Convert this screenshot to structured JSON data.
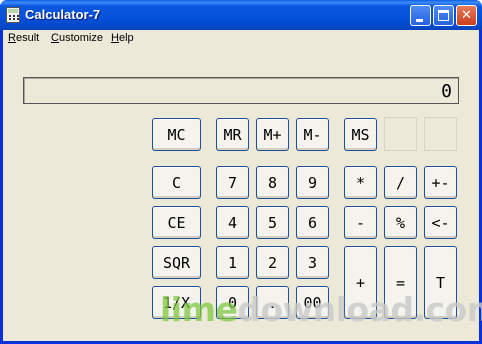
{
  "window": {
    "title": "Calculator-7",
    "icon": "calculator-icon"
  },
  "menu": {
    "items": [
      {
        "label": "Result",
        "mnemonic": "R",
        "rest": "esult"
      },
      {
        "label": "Customize",
        "mnemonic": "C",
        "rest": "ustomize"
      },
      {
        "label": "Help",
        "mnemonic": "H",
        "rest": "elp"
      }
    ]
  },
  "display": {
    "value": "0"
  },
  "memory_row": {
    "mc": "MC",
    "mr": "MR",
    "mplus": "M+",
    "mminus": "M-",
    "ms": "MS"
  },
  "keys": {
    "clear": "C",
    "clear_entry": "CE",
    "sqr": "SQR",
    "reciprocal": "1/X",
    "d7": "7",
    "d8": "8",
    "d9": "9",
    "d4": "4",
    "d5": "5",
    "d6": "6",
    "d1": "1",
    "d2": "2",
    "d3": "3",
    "d0": "0",
    "dot": ".",
    "d00": "00",
    "multiply": "*",
    "divide": "/",
    "negate": "+-",
    "minus": "-",
    "percent": "%",
    "backspace": "<-",
    "plus": "+",
    "equals": "=",
    "total": "T"
  },
  "watermark": {
    "part1": "lime",
    "part2": "download.com"
  },
  "colors": {
    "titlebar": "#0551d9",
    "button_border": "#1c4f9c",
    "client_bg": "#ece9d8"
  }
}
